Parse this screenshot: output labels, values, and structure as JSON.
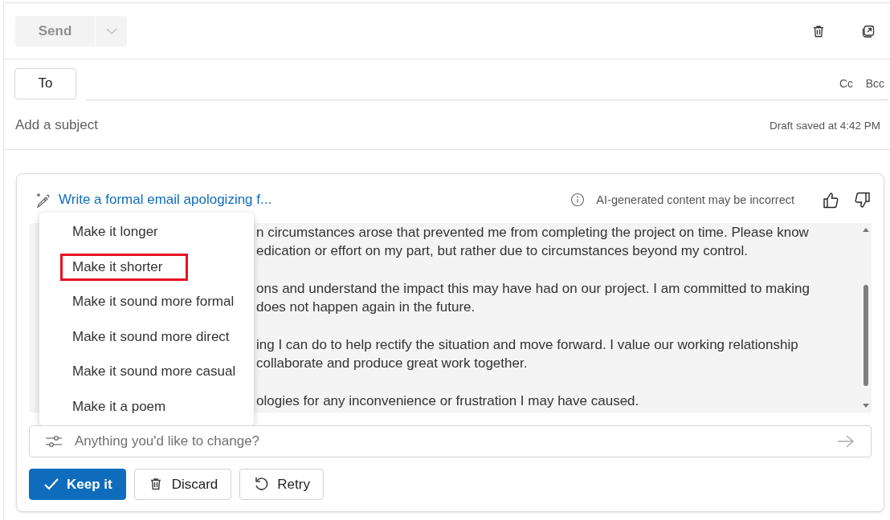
{
  "toolbar": {
    "send": {
      "label": "Send",
      "disabled": true
    }
  },
  "recipients": {
    "to_label": "To",
    "cc": "Cc",
    "bcc": "Bcc"
  },
  "subject": {
    "placeholder": "Add a subject",
    "draft_status": "Draft saved at 4:42 PM"
  },
  "copilot": {
    "prompt": "Write a formal email apologizing f...",
    "disclaimer": "AI-generated content may be incorrect",
    "body_paragraphs": [
      [
        "n circumstances arose that prevented me from completing the project on time. Please know",
        "edication or effort on my part, but rather due to circumstances beyond my control."
      ],
      [
        "ons and understand the impact this may have had on our project. I am committed to making",
        "does not happen again in the future."
      ],
      [
        "ing I can do to help rectify the situation and move forward. I value our working relationship",
        "collaborate and produce great work together."
      ],
      [
        "ologies for any inconvenience or frustration I may have caused."
      ]
    ],
    "menu": [
      {
        "label": "Make it longer",
        "selected": false
      },
      {
        "label": "Make it shorter",
        "selected": true
      },
      {
        "label": "Make it sound more formal",
        "selected": false
      },
      {
        "label": "Make it sound more direct",
        "selected": false
      },
      {
        "label": "Make it sound more casual",
        "selected": false
      },
      {
        "label": "Make it a poem",
        "selected": false
      }
    ],
    "change_field": {
      "placeholder": "Anything you'd like to change?"
    },
    "buttons": [
      {
        "kind": "keep",
        "label": "Keep it"
      },
      {
        "kind": "discard",
        "label": "Discard"
      },
      {
        "kind": "retry",
        "label": "Retry"
      }
    ]
  }
}
